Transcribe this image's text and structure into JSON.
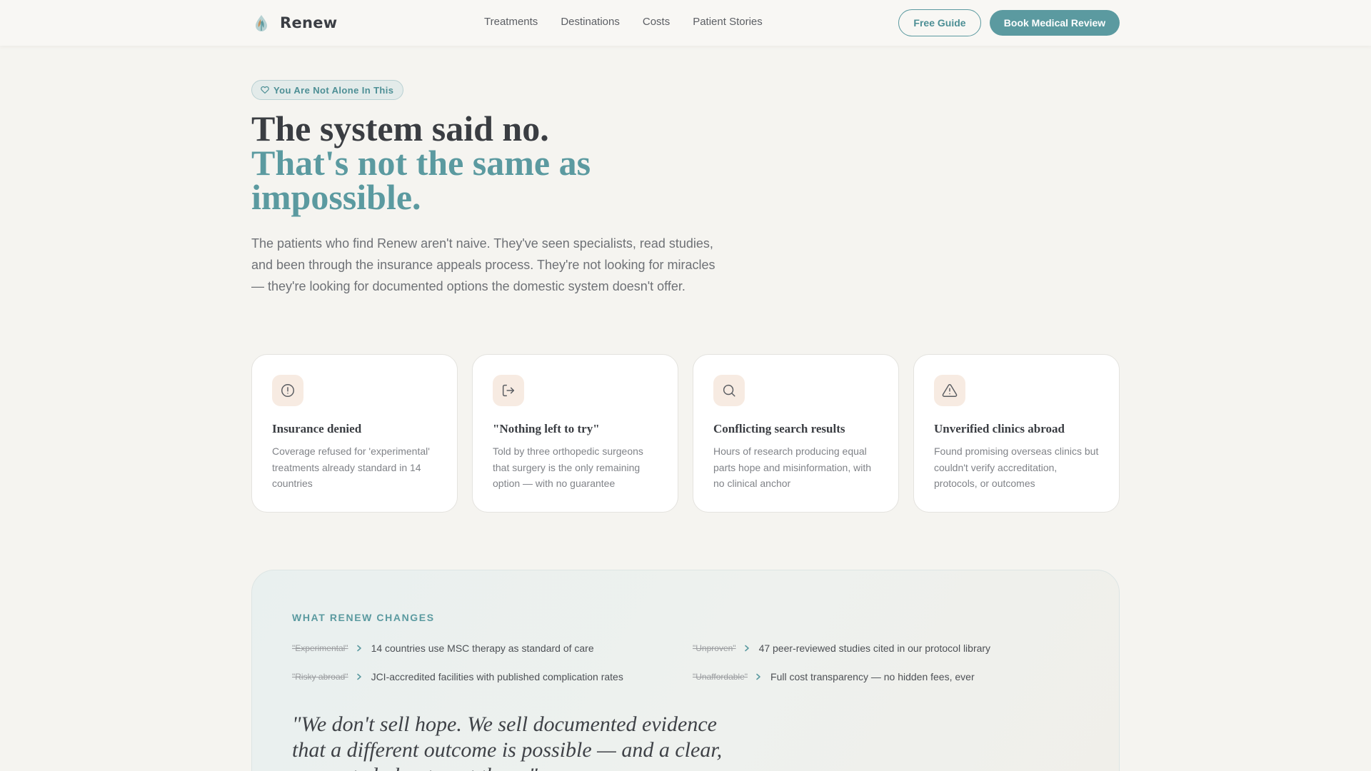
{
  "brand": {
    "name": "Renew",
    "logo_icon": "droplet-leaf-icon",
    "accent": "#5b9aa0"
  },
  "nav": {
    "links": [
      "Treatments",
      "Destinations",
      "Costs",
      "Patient Stories"
    ],
    "guide_label": "Free Guide",
    "book_label": "Book Medical Review"
  },
  "hero": {
    "badge": "You Are Not Alone In This",
    "title_line1": "The system said no.",
    "title_line2": "That's not the same as impossible.",
    "description": "The patients who find Renew aren't naive. They've seen specialists, read studies, and been through the insurance appeals process. They're not looking for miracles — they're looking for documented options the domestic system doesn't offer."
  },
  "cards": [
    {
      "icon": "alert-circle-icon",
      "title": "Insurance denied",
      "text": "Coverage refused for 'experimental' treatments already standard in 14 countries"
    },
    {
      "icon": "exit-arrow-icon",
      "title": "\"Nothing left to try\"",
      "text": "Told by three orthopedic surgeons that surgery is the only remaining option — with no guarantee"
    },
    {
      "icon": "search-icon",
      "title": "Conflicting search results",
      "text": "Hours of research producing equal parts hope and misinformation, with no clinical anchor"
    },
    {
      "icon": "warning-triangle-icon",
      "title": "Unverified clinics abroad",
      "text": "Found promising overseas clinics but couldn't verify accreditation, protocols, or outcomes"
    }
  ],
  "changes": {
    "label": "WHAT RENEW CHANGES",
    "items": [
      {
        "from": "\"Experimental\"",
        "to": "14 countries use MSC therapy as standard of care"
      },
      {
        "from": "\"Unproven\"",
        "to": "47 peer-reviewed studies cited in our protocol library"
      },
      {
        "from": "\"Risky abroad\"",
        "to": "JCI-accredited facilities with published complication rates"
      },
      {
        "from": "\"Unaffordable\"",
        "to": "Full cost transparency — no hidden fees, ever"
      }
    ],
    "quote": "\"We don't sell hope. We sell documented evidence that a different outcome is possible — and a clear, supported plan to get there.\""
  }
}
